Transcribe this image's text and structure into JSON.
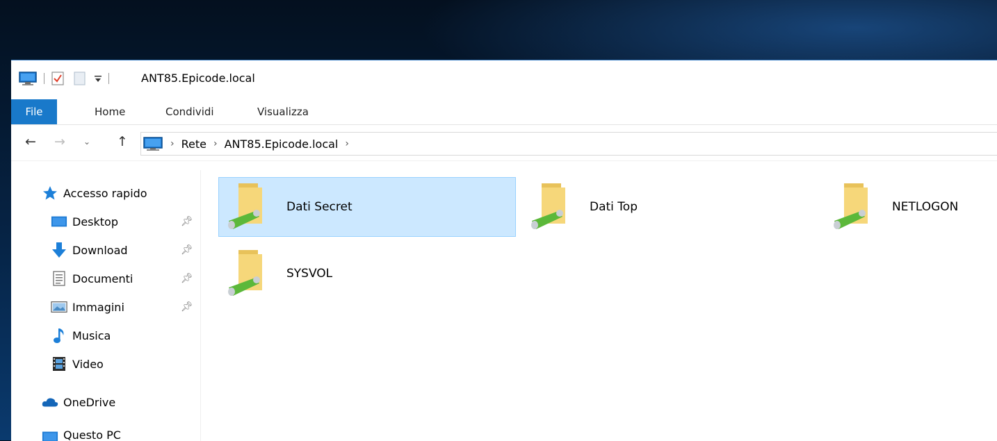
{
  "window": {
    "title": "ANT85.Epicode.local"
  },
  "ribbon": {
    "tabs": [
      {
        "label": "File"
      },
      {
        "label": "Home"
      },
      {
        "label": "Condividi"
      },
      {
        "label": "Visualizza"
      }
    ]
  },
  "address": {
    "segments": [
      "Rete",
      "ANT85.Epicode.local"
    ],
    "chevron": "›"
  },
  "sidebar": {
    "quick_access": "Accesso rapido",
    "items": [
      {
        "label": "Desktop",
        "icon": "desktop-icon",
        "pinned": true
      },
      {
        "label": "Download",
        "icon": "download-arrow-icon",
        "pinned": true
      },
      {
        "label": "Documenti",
        "icon": "document-icon",
        "pinned": true
      },
      {
        "label": "Immagini",
        "icon": "pictures-icon",
        "pinned": true
      },
      {
        "label": "Musica",
        "icon": "music-note-icon",
        "pinned": false
      },
      {
        "label": "Video",
        "icon": "video-icon",
        "pinned": false
      }
    ],
    "onedrive": "OneDrive",
    "this_pc": "Questo PC"
  },
  "shares": [
    {
      "label": "Dati Secret",
      "selected": true
    },
    {
      "label": "Dati Top",
      "selected": false
    },
    {
      "label": "NETLOGON",
      "selected": false
    },
    {
      "label": "SYSVOL",
      "selected": false
    }
  ],
  "colors": {
    "file_tab": "#1979ca",
    "selection": "#cce8ff",
    "folder": "#f6d77a",
    "share_pipe": "#5cb83a"
  }
}
